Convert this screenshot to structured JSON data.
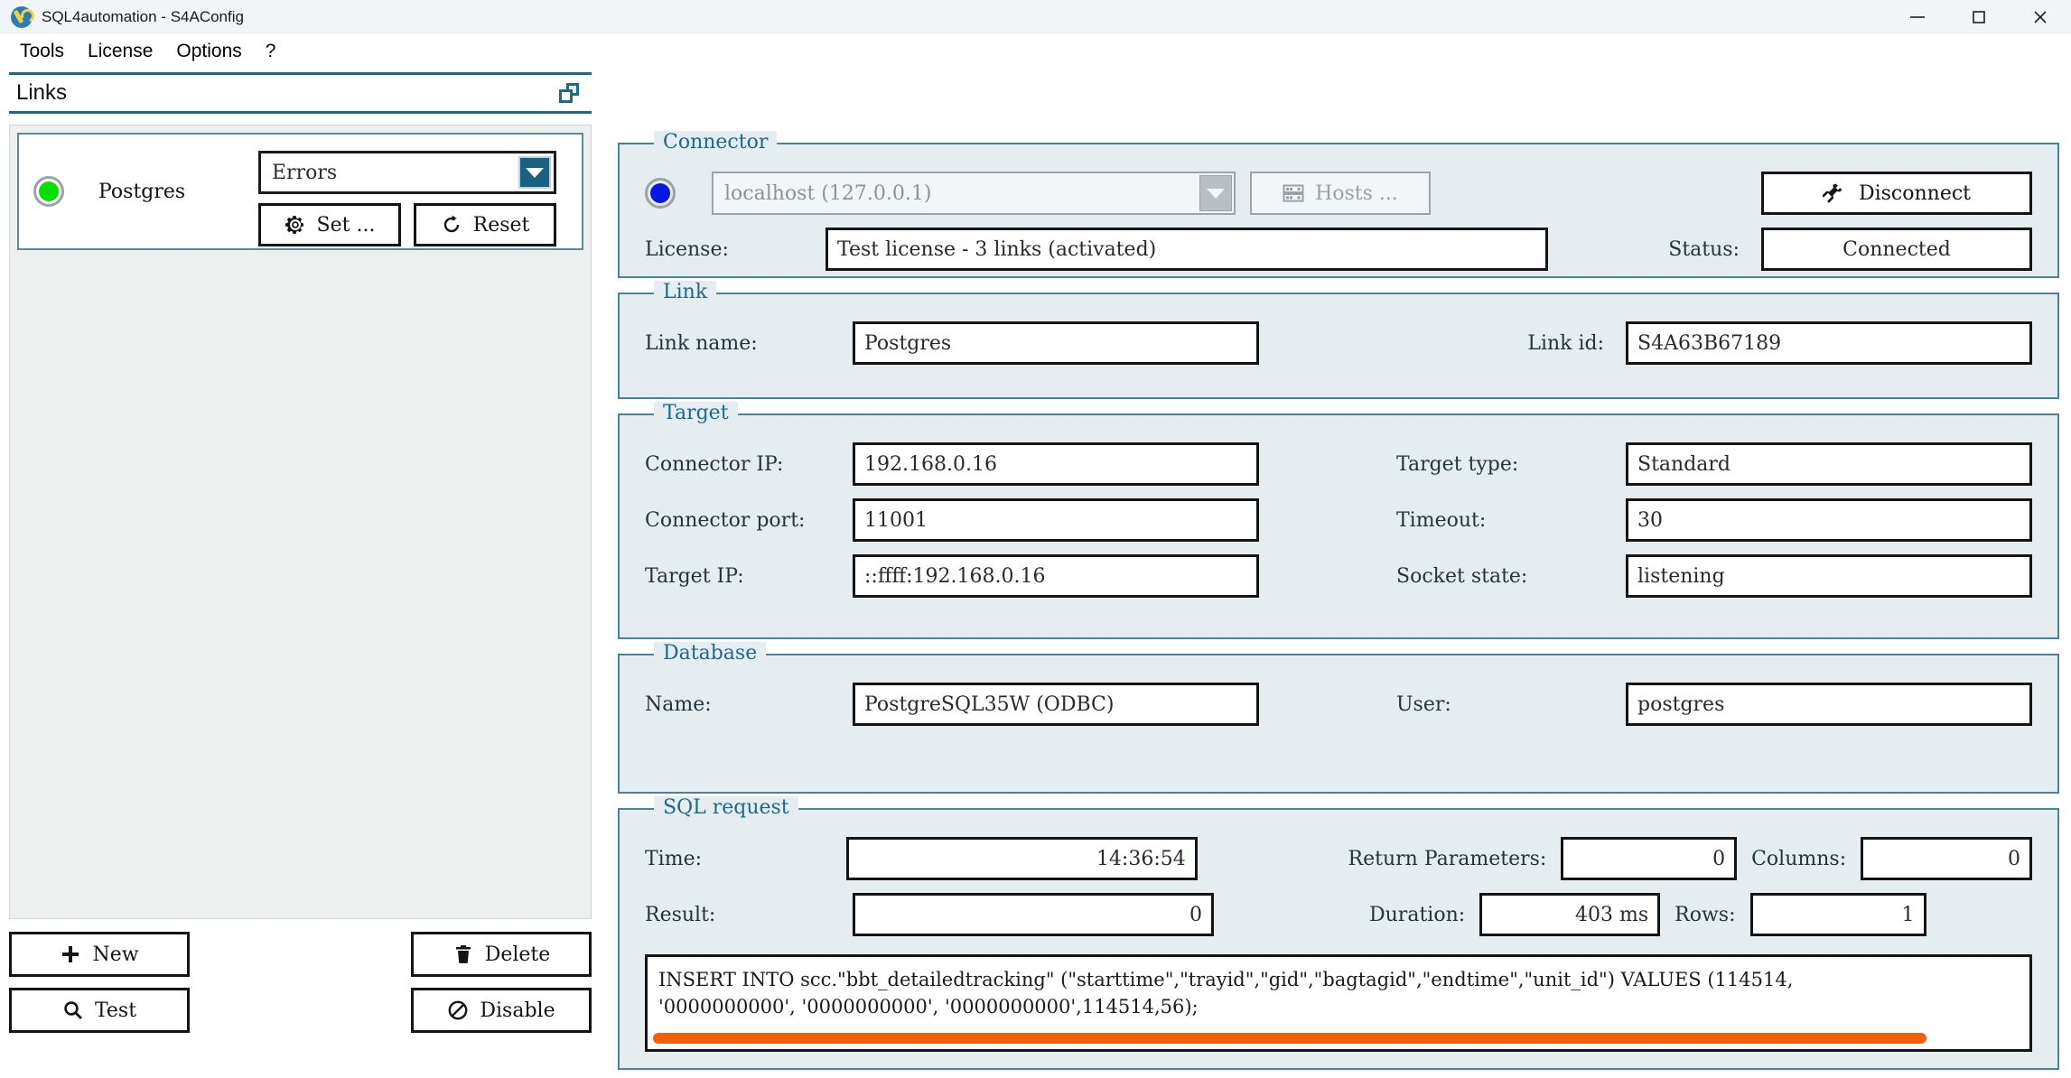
{
  "window": {
    "title": "SQL4automation - S4AConfig",
    "icon": "wrench-icon",
    "minimize_label": "—",
    "maximize_label": "☐",
    "close_label": "✕"
  },
  "menu": {
    "items": [
      {
        "label": "Tools"
      },
      {
        "label": "License"
      },
      {
        "label": "Options"
      },
      {
        "label": "?"
      }
    ]
  },
  "dock": {
    "title": "Links",
    "float_icon": "restore-panel-icon",
    "link_card": {
      "status_led": "green",
      "name": "Postgres",
      "filter_value": "Errors",
      "set_label": "Set ...",
      "reset_label": "Reset"
    },
    "footer": {
      "new_label": "New",
      "test_label": "Test",
      "delete_label": "Delete",
      "disable_label": "Disable"
    }
  },
  "connector": {
    "legend": "Connector",
    "status_led": "blue",
    "host_value": "localhost (127.0.0.1)",
    "hosts_label": "Hosts ...",
    "license_label": "License:",
    "license_value": "Test license - 3 links (activated)",
    "disconnect_label": "Disconnect",
    "status_label": "Status:",
    "status_value": "Connected"
  },
  "link": {
    "legend": "Link",
    "name_label": "Link name:",
    "name_value": "Postgres",
    "id_label": "Link id:",
    "id_value": "S4A63B67189"
  },
  "target": {
    "legend": "Target",
    "connector_ip_label": "Connector IP:",
    "connector_ip_value": "192.168.0.16",
    "connector_port_label": "Connector port:",
    "connector_port_value": "11001",
    "target_ip_label": "Target IP:",
    "target_ip_value": "::ffff:192.168.0.16",
    "target_type_label": "Target type:",
    "target_type_value": "Standard",
    "timeout_label": "Timeout:",
    "timeout_value": "30",
    "socket_state_label": "Socket state:",
    "socket_state_value": "listening"
  },
  "database": {
    "legend": "Database",
    "name_label": "Name:",
    "name_value": "PostgreSQL35W (ODBC)",
    "user_label": "User:",
    "user_value": "postgres"
  },
  "sql_request": {
    "legend": "SQL request",
    "time_label": "Time:",
    "time_value": "14:36:54",
    "result_label": "Result:",
    "result_value": "0",
    "return_parameters_label": "Return Parameters:",
    "return_parameters_value": "0",
    "columns_label": "Columns:",
    "columns_value": "0",
    "duration_label": "Duration:",
    "duration_value": "403 ms",
    "rows_label": "Rows:",
    "rows_value": "1",
    "statement": "INSERT INTO scc.\"bbt_detailedtracking\" (\"starttime\",\"trayid\",\"gid\",\"bagtagid\",\"endtime\",\"unit_id\") VALUES (114514,\n'0000000000', '0000000000', '0000000000',114514,56);",
    "scrollbar_color": "#f2600c"
  }
}
